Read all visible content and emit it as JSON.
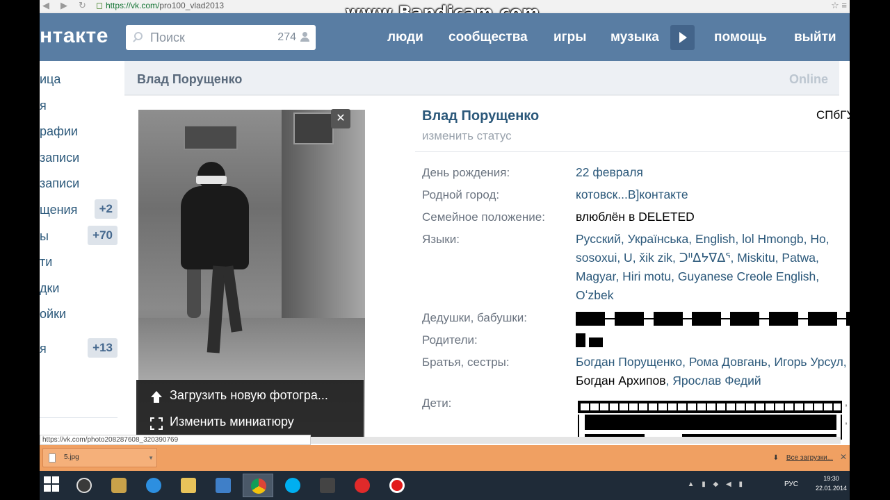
{
  "browser": {
    "url_host": "https://vk.com/",
    "url_path": "pro100_vlad2013",
    "watermark": "www.Bandicam.com",
    "status_url": "https://vk.com/photo208287608_320390769"
  },
  "header": {
    "logo": "нтакте",
    "search_placeholder": "Поиск",
    "search_count": "274",
    "nav": [
      "люди",
      "сообщества",
      "игры",
      "музыка",
      "помощь",
      "выйти"
    ]
  },
  "leftmenu": {
    "items": [
      {
        "label": "ица",
        "badge": ""
      },
      {
        "label": "я",
        "badge": ""
      },
      {
        "label": "рафии",
        "badge": ""
      },
      {
        "label": "записи",
        "badge": ""
      },
      {
        "label": "записи",
        "badge": ""
      },
      {
        "label": "щения",
        "badge": "+2"
      },
      {
        "label": "ы",
        "badge": "+70"
      },
      {
        "label": "ти",
        "badge": ""
      },
      {
        "label": "дки",
        "badge": ""
      },
      {
        "label": "ойки",
        "badge": ""
      },
      {
        "label": "я",
        "badge": "+13"
      }
    ]
  },
  "page": {
    "head_name": "Влад Порущенко",
    "online": "Online"
  },
  "avatar_menu": {
    "upload": "Загрузить новую фотогра...",
    "thumbnail": "Изменить миниатюру",
    "close": "✕"
  },
  "profile": {
    "name": "Влад Порущенко",
    "status": "изменить статус",
    "university": "СПбГУ",
    "rows": {
      "birthday": {
        "label": "День рождения:",
        "value": "22 февраля"
      },
      "hometown": {
        "label": "Родной город:",
        "value": "котовск...В]контакте"
      },
      "relationship": {
        "label": "Семейное положение:",
        "value": "влюблён в DELETED"
      },
      "languages": {
        "label": "Языки:",
        "value": "Русский, Українська, English, lol Hmongb, Ho, sosoxui, U, x̌ik zik, ᑐᐦᐃᔭᐁᐃᕐ, Miskitu, Patwa, Magyar, Hiri motu, Guyanese Creole English, Oʻzbek"
      },
      "grandparents": {
        "label": "Дедушки, бабушки:",
        "value": ""
      },
      "parents": {
        "label": "Родители:",
        "value": ""
      },
      "siblings": {
        "label": "Братья, сестры:",
        "value_a": "Богдан Порущенко, Рома Довгань, Игорь Урсул, ",
        "value_b": "Богдан Архипов",
        "value_c": ", Ярослав Федий"
      },
      "children": {
        "label": "Дети:",
        "value": ""
      }
    }
  },
  "downloads": {
    "file": "5.jpg",
    "all": "Все загрузки...",
    "close": "✕"
  },
  "taskbar": {
    "lang": "РУС",
    "time": "19:30",
    "date": "22.01.2014"
  },
  "colors": {
    "header_bg": "#597da3",
    "link": "#2b587a",
    "download_bar": "#f0a062",
    "taskbar": "#1f2b38"
  }
}
